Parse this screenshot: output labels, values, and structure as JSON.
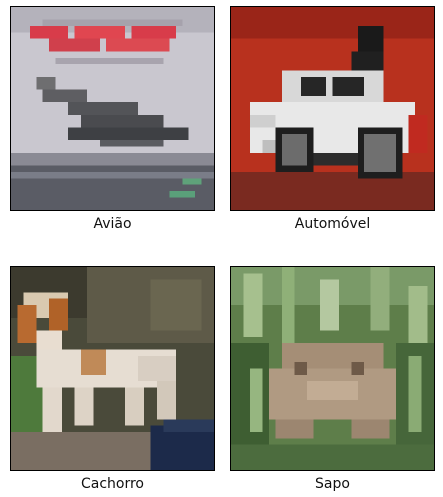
{
  "images": [
    {
      "label": "Avião",
      "subject": "airplane"
    },
    {
      "label": "Automóvel",
      "subject": "car"
    },
    {
      "label": "Cachorro",
      "subject": "dog"
    },
    {
      "label": "Sapo",
      "subject": "frog"
    }
  ]
}
